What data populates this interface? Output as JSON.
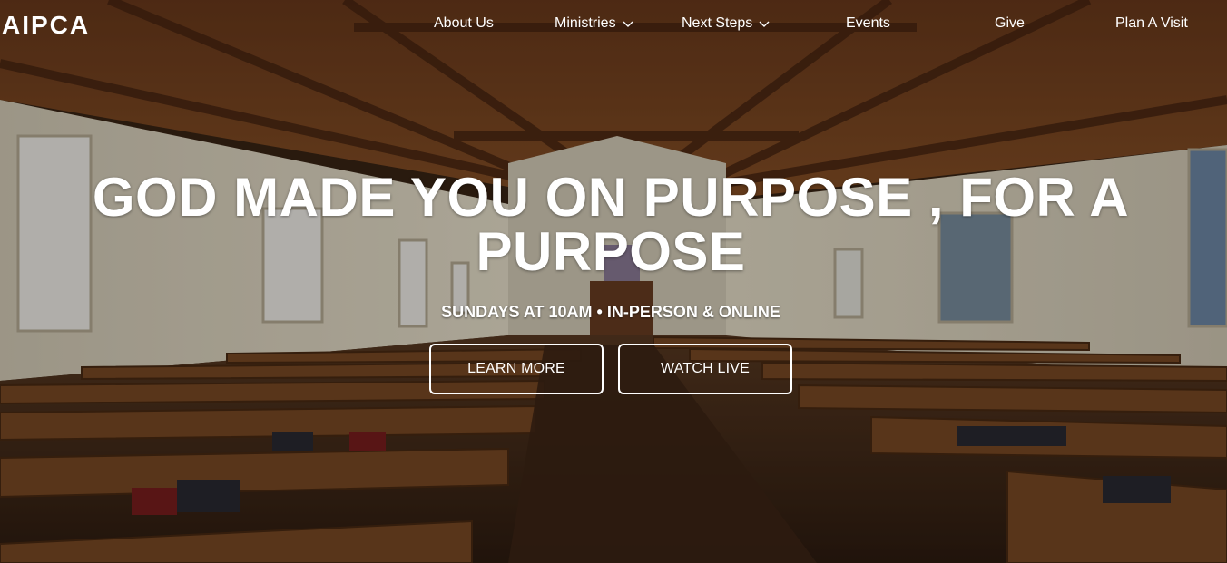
{
  "brand": {
    "logo_text": "AIPCA"
  },
  "nav": {
    "about": "About Us",
    "ministries": "Ministries",
    "next_steps": "Next Steps",
    "events": "Events",
    "give": "Give",
    "plan_visit": "Plan A Visit"
  },
  "hero": {
    "headline": "GOD MADE YOU ON PURPOSE , FOR A PURPOSE",
    "subline": "SUNDAYS AT 10AM • IN-PERSON & ONLINE",
    "learn_more": "LEARN MORE",
    "watch_live": "WATCH LIVE"
  },
  "icons": {
    "dropdown": "chevron-down-icon"
  },
  "colors": {
    "text": "#ffffff",
    "button_border": "#ffffff"
  }
}
